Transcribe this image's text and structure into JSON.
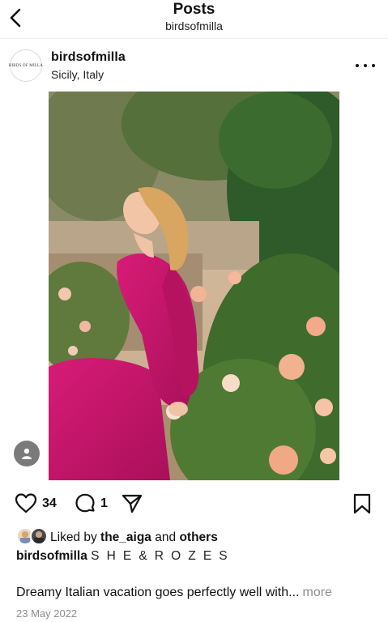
{
  "header": {
    "title": "Posts",
    "subtitle": "birdsofmilla"
  },
  "post": {
    "avatar_text": "BIRDS OF MILLA",
    "username": "birdsofmilla",
    "location": "Sicily, Italy",
    "like_count": "34",
    "comment_count": "1",
    "liked_by_prefix": "Liked by",
    "liked_by_user": "the_aiga",
    "liked_by_and": "and",
    "liked_by_others": "others",
    "caption_user": "birdsofmilla",
    "caption_title": "S H E & R O Z E S",
    "description": "Dreamy Italian vacation goes perfectly well with...",
    "more_label": "more",
    "date": "23 May 2022"
  },
  "icons": {
    "back": "chevron-left-icon",
    "more": "more-horizontal-icon",
    "like": "heart-icon",
    "comment": "comment-icon",
    "share": "paper-plane-icon",
    "save": "bookmark-icon",
    "tags": "user-icon"
  },
  "colors": {
    "text": "#111111",
    "secondary": "#8e8e8e",
    "dress": "#c2186b"
  }
}
